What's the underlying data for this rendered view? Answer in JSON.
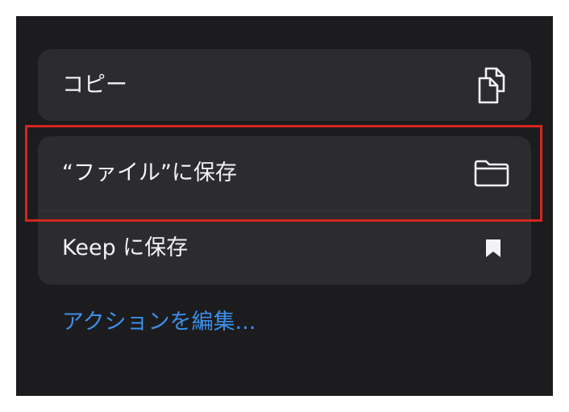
{
  "menu": {
    "items": [
      {
        "label": "コピー",
        "icon": "copy-icon"
      },
      {
        "label": "“ファイル”に保存",
        "icon": "folder-icon"
      },
      {
        "label": "Keep に保存",
        "icon": "bookmark-icon"
      }
    ],
    "edit_actions_label": "アクションを編集..."
  },
  "colors": {
    "background": "#1c1c1e",
    "group_background": "#2c2c2e",
    "label_text": "#f2f2f7",
    "link": "#3d8ee8",
    "highlight_border": "#d5251e"
  }
}
